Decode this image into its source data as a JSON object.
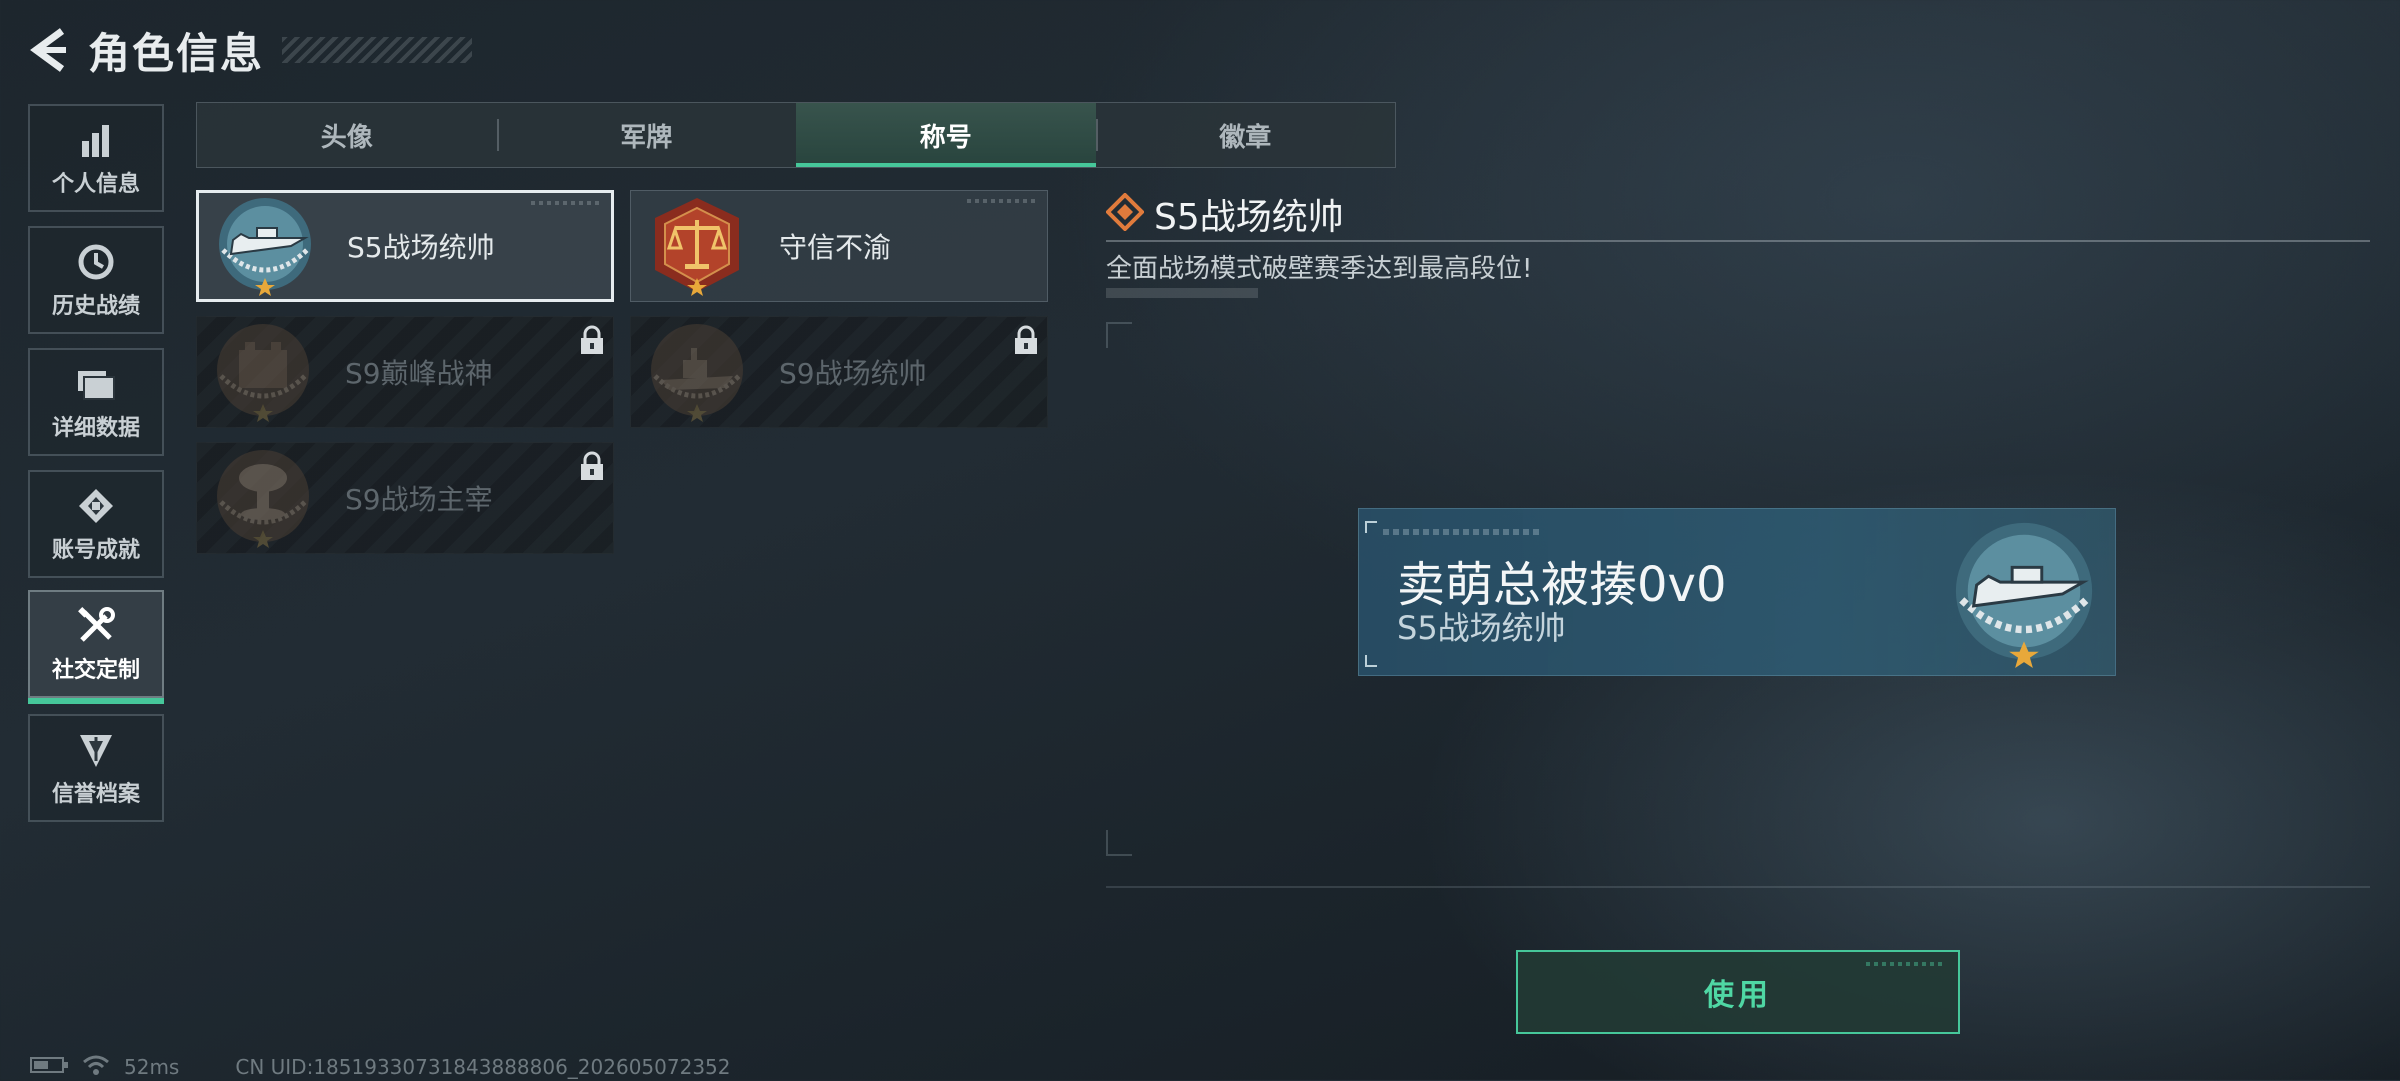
{
  "header": {
    "title": "角色信息"
  },
  "sidebar": {
    "items": [
      {
        "label": "个人信息",
        "icon": "bar-chart-icon",
        "active": false
      },
      {
        "label": "历史战绩",
        "icon": "clock-icon",
        "active": false
      },
      {
        "label": "详细数据",
        "icon": "folder-icon",
        "active": false
      },
      {
        "label": "账号成就",
        "icon": "achievement-icon",
        "active": false
      },
      {
        "label": "社交定制",
        "icon": "tools-icon",
        "active": true
      },
      {
        "label": "信誉档案",
        "icon": "reputation-icon",
        "active": false
      }
    ]
  },
  "tabs": [
    {
      "label": "头像",
      "active": false
    },
    {
      "label": "军牌",
      "active": false
    },
    {
      "label": "称号",
      "active": true
    },
    {
      "label": "徽章",
      "active": false
    }
  ],
  "title_cards": [
    {
      "label": "S5战场统帅",
      "emblem": "speedboat-emblem-icon",
      "locked": false,
      "selected": true
    },
    {
      "label": "守信不渝",
      "emblem": "scales-emblem-icon",
      "locked": false,
      "selected": false
    },
    {
      "label": "S9巅峰战神",
      "emblem": "fortress-emblem-icon",
      "locked": true,
      "selected": false
    },
    {
      "label": "S9战场统帅",
      "emblem": "warship-emblem-icon",
      "locked": true,
      "selected": false
    },
    {
      "label": "S9战场主宰",
      "emblem": "mushroom-cloud-emblem-icon",
      "locked": true,
      "selected": false
    }
  ],
  "detail": {
    "title": "S5战场统帅",
    "description": "全面战场模式破壁赛季达到最高段位!"
  },
  "preview": {
    "player_name": "卖萌总被揍0v0",
    "title": "S5战场统帅"
  },
  "use_button": {
    "label": "使用"
  },
  "status": {
    "latency": "52ms",
    "uid": "CN UID:18519330731843888806_202605072352"
  },
  "colors": {
    "accent_green": "#46c79a",
    "use_button_text": "#4fd7a4",
    "star_gold": "#e8a83a",
    "diamond_orange": "#e07b3c"
  }
}
